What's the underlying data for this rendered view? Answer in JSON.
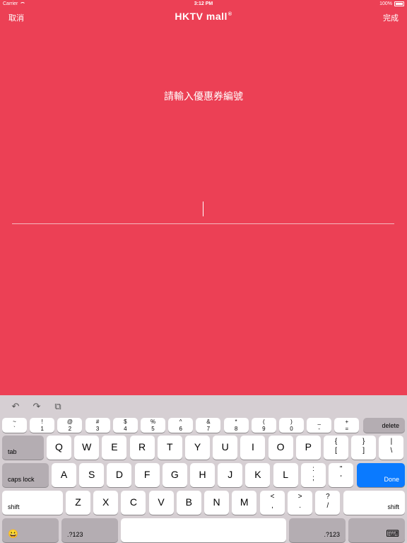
{
  "status_bar": {
    "carrier": "Carrier",
    "time": "3:12 PM",
    "battery": "100%"
  },
  "nav": {
    "cancel": "取消",
    "logo": "HKTV mall",
    "logo_mark": "®",
    "done": "完成"
  },
  "prompt": "請輸入優惠券編號",
  "keyboard": {
    "row_numbers": [
      {
        "top": "~",
        "bot": "`"
      },
      {
        "top": "!",
        "bot": "1"
      },
      {
        "top": "@",
        "bot": "2"
      },
      {
        "top": "#",
        "bot": "3"
      },
      {
        "top": "$",
        "bot": "4"
      },
      {
        "top": "%",
        "bot": "5"
      },
      {
        "top": "^",
        "bot": "6"
      },
      {
        "top": "&",
        "bot": "7"
      },
      {
        "top": "*",
        "bot": "8"
      },
      {
        "top": "(",
        "bot": "9"
      },
      {
        "top": ")",
        "bot": "0"
      },
      {
        "top": "_",
        "bot": "-"
      },
      {
        "top": "+",
        "bot": "="
      }
    ],
    "delete": "delete",
    "tab": "tab",
    "row_q": [
      "Q",
      "W",
      "E",
      "R",
      "T",
      "Y",
      "U",
      "I",
      "O",
      "P"
    ],
    "row_q_syms": [
      {
        "top": "{",
        "bot": "["
      },
      {
        "top": "}",
        "bot": "]"
      },
      {
        "top": "|",
        "bot": "\\"
      }
    ],
    "caps_lock": "caps lock",
    "row_a": [
      "A",
      "S",
      "D",
      "F",
      "G",
      "H",
      "J",
      "K",
      "L"
    ],
    "row_a_syms": [
      {
        "top": ":",
        "bot": ";"
      },
      {
        "top": "\"",
        "bot": "'"
      }
    ],
    "done": "Done",
    "shift": "shift",
    "row_z": [
      "Z",
      "X",
      "C",
      "V",
      "B",
      "N",
      "M"
    ],
    "row_z_syms": [
      {
        "top": "<",
        "bot": ","
      },
      {
        "top": ">",
        "bot": "."
      },
      {
        "top": "?",
        "bot": "/"
      }
    ],
    "emoji": "😀",
    "num_switch": ".?123",
    "colors": {
      "accent": "#0A7AFF",
      "background": "#EC4055"
    }
  }
}
